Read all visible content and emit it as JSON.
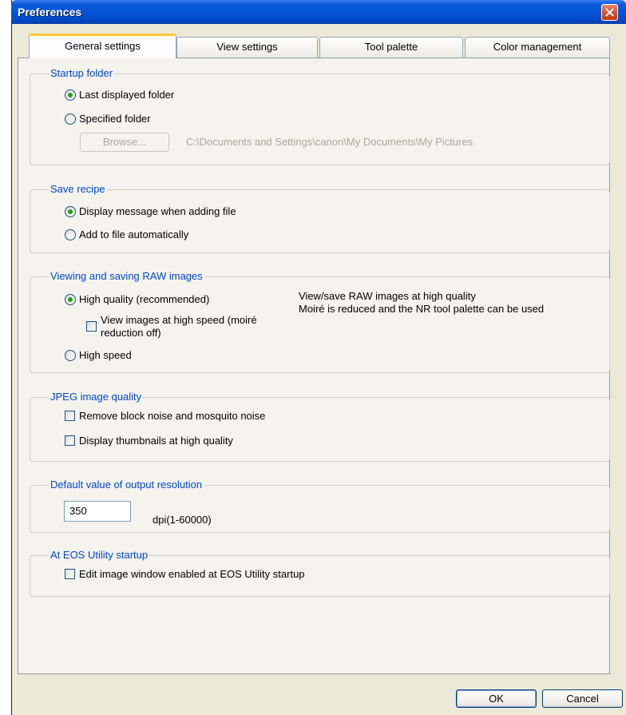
{
  "window": {
    "title": "Preferences"
  },
  "tabs": [
    {
      "label": "General settings",
      "active": true
    },
    {
      "label": "View settings",
      "active": false
    },
    {
      "label": "Tool palette",
      "active": false
    },
    {
      "label": "Color management",
      "active": false
    }
  ],
  "startup_folder": {
    "title": "Startup folder",
    "last_displayed": "Last displayed folder",
    "specified": "Specified folder",
    "browse_label": "Browse...",
    "path": "C:\\Documents and Settings\\canon\\My Documents\\My Pictures",
    "selected": "last_displayed"
  },
  "save_recipe": {
    "title": "Save recipe",
    "display_message": "Display message when adding file",
    "add_auto": "Add to file automatically",
    "selected": "display_message"
  },
  "raw_images": {
    "title": "Viewing and saving RAW images",
    "high_quality": "High quality (recommended)",
    "high_speed_view_line1": "View images at high speed (moiré",
    "high_speed_view_line2": "reduction off)",
    "high_speed": "High speed",
    "description_line1": "View/save RAW images at high quality",
    "description_line2": "Moiré is reduced and the NR tool palette can be used",
    "selected": "high_quality"
  },
  "jpeg": {
    "title": "JPEG image quality",
    "remove_noise": "Remove block noise and mosquito noise",
    "thumbnails": "Display thumbnails at high quality"
  },
  "output_resolution": {
    "title": "Default value of output resolution",
    "value": "350",
    "unit": "dpi(1-60000)"
  },
  "eos_utility": {
    "title": "At EOS Utility startup",
    "edit_window": "Edit image window enabled at EOS Utility startup"
  },
  "buttons": {
    "ok": "OK",
    "cancel": "Cancel"
  },
  "colors": {
    "titlebar": "#0453d6",
    "legend": "#0046d5",
    "window_bg": "#ece9d8",
    "radio_dot": "#21a121"
  }
}
